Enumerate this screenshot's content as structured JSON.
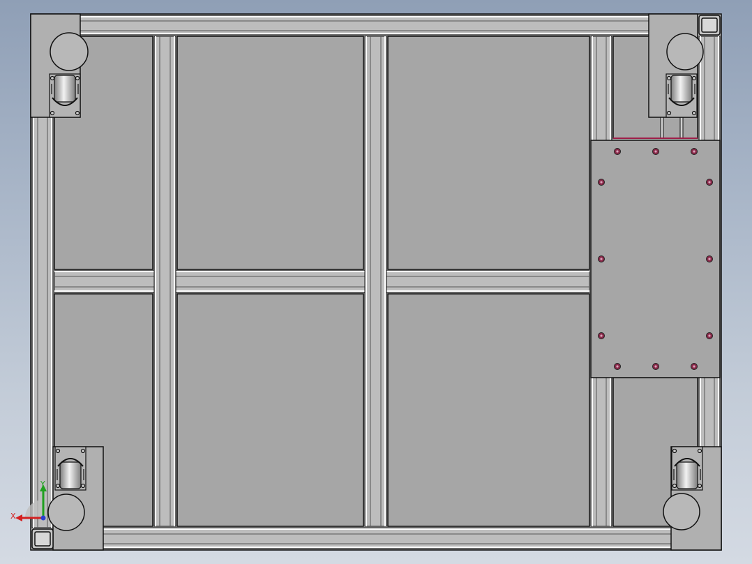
{
  "viewport": {
    "view": "Bottom",
    "background_top": "#8f9fb6",
    "background_bottom": "#d4dae3"
  },
  "model": {
    "description_parts": [
      "aluminum-profile-frame",
      "bottom-cover-panels",
      "mounting-plate",
      "caster-wheels",
      "corner-brackets"
    ],
    "panel_color": "#a6a6a6",
    "profile_color": "#b9b9b9",
    "edge_color": "#1a1a1a",
    "highlight_color": "#ffffff",
    "hole_color": "#8a2a4a",
    "casters": [
      "caster-top-left",
      "caster-top-right",
      "caster-bottom-left",
      "caster-bottom-right"
    ]
  },
  "triad": {
    "x_label": "X",
    "y_label": "Y",
    "x_color": "#d42020",
    "y_color": "#1fa01f",
    "z_color": "#2a3fd0"
  }
}
